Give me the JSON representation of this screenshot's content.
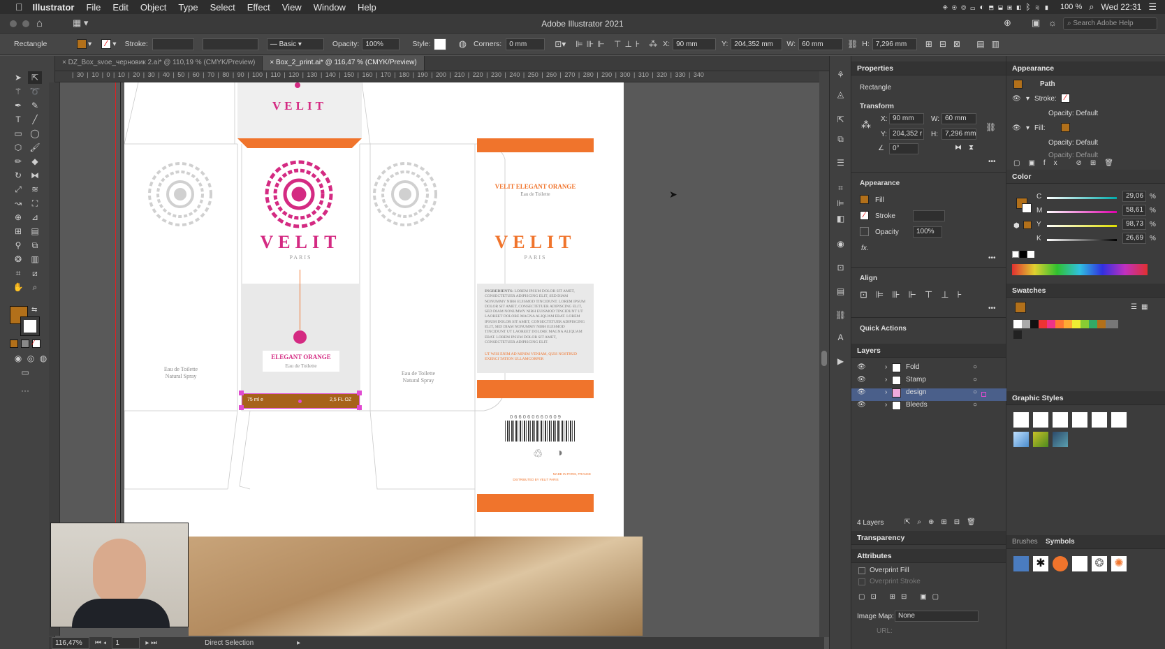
{
  "menubar": {
    "app": "Illustrator",
    "items": [
      "File",
      "Edit",
      "Object",
      "Type",
      "Select",
      "Effect",
      "View",
      "Window",
      "Help"
    ],
    "battery": "100 %",
    "clock": "Wed 22:31"
  },
  "window": {
    "title": "Adobe Illustrator 2021",
    "search_placeholder": "Search Adobe Help"
  },
  "control": {
    "object_type": "Rectangle",
    "stroke_label": "Stroke:",
    "profile": "Basic",
    "opacity_label": "Opacity:",
    "opacity": "100%",
    "style_label": "Style:",
    "corners_label": "Corners:",
    "corners": "0 mm",
    "x_label": "X:",
    "x": "90 mm",
    "y_label": "Y:",
    "y": "204,352 mm",
    "w_label": "W:",
    "w": "60 mm",
    "h_label": "H:",
    "h": "7,296 mm"
  },
  "tabs": [
    "DZ_Box_svoe_черновик 2.ai* @ 110,19 % (CMYK/Preview)",
    "Box_2_print.ai* @ 116,47 % (CMYK/Preview)"
  ],
  "ruler": "| 30 | 10 | 0 | 10 | 20 | 30 | 40 | 50 | 60 | 70 | 80 | 90 | 100 | 110 | 120 | 130 | 140 | 150 | 160 | 170 | 180 | 190 | 200 | 210 | 220 | 230 | 240 | 250 | 260 | 270 | 280 | 290 | 300 | 310 | 320 | 330 | 340",
  "artboard": {
    "brand": "VELIT",
    "city": "PARIS",
    "left_label1": "Eau de Toilette",
    "left_label2": "Natural Spray",
    "mid_label1": "Eau de Toilette",
    "mid_label2": "Natural Spray",
    "product": "ELEGANT ORANGE",
    "product_sub": "Eau de Toilette",
    "strip_left": "75 ml e",
    "strip_right": "2,5 FL OZ",
    "side_title": "VELIT ELEGANT ORANGE",
    "side_sub": "Eau de Toilette",
    "ingredients_title": "INGREDIENTS:",
    "ingredients": "LOREM IPSUM DOLOR SIT AMET, CONSECTETUER ADIPISCING ELIT, SED DIAM NONUMMY NIBH EUISMOD TINCIDUNT. LOREM IPSUM DOLOR SIT AMET, CONSECTETUER ADIPISCING ELIT, SED DIAM NONUMMY NIBH EUISMOD TINCIDUNT UT LAOREET DOLORE MAGNA ALIQUAM ERAT. LOREM IPSUM DOLOR SIT AMET, CONSECTETUER ADIPISCING ELIT, SED DIAM NONUMMY NIBH EUISMOD TINCIDUNT UT LAOREET DOLORE MAGNA ALIQUAM ERAT. LOREM IPSUM DOLOR SIT AMET, CONSECTETUER ADIPISCING ELIT.",
    "ingredients_orange": "UT WISI ENIM AD MINIM VENIAM, QUIS NOSTRUD EXERCI TATION ULLAMCORPER",
    "barcode": "0 6 6 0 6 0 6 6 0 6 0 9",
    "fine1": "MADE IN PARIS, FRANCE",
    "fine2": "DISTRIBUTED BY VELIT PARIS"
  },
  "status": {
    "zoom": "116,47%",
    "page": "1",
    "tool": "Direct Selection"
  },
  "properties": {
    "tab": "Properties",
    "type": "Rectangle",
    "transform": "Transform",
    "x_label": "X:",
    "x": "90 mm",
    "w_label": "W:",
    "w": "60 mm",
    "y_label": "Y:",
    "y": "204,352 r",
    "h_label": "H:",
    "h": "7,296 mm",
    "angle": "0°",
    "appearance": "Appearance",
    "fill": "Fill",
    "stroke": "Stroke",
    "opacity": "Opacity",
    "opacity_val": "100%",
    "fx": "fx.",
    "align": "Align",
    "quick": "Quick Actions"
  },
  "layers": {
    "title": "Layers",
    "items": [
      "Fold",
      "Stamp",
      "design",
      "Bleeds"
    ],
    "count": "4 Layers"
  },
  "transparency": "Transparency",
  "attributes": {
    "title": "Attributes",
    "overprint_fill": "Overprint Fill",
    "overprint_stroke": "Overprint Stroke",
    "image_map": "Image Map:",
    "image_map_val": "None",
    "url": "URL:"
  },
  "appearance_panel": {
    "title": "Appearance",
    "path": "Path",
    "stroke": "Stroke:",
    "opacity1": "Opacity:",
    "opacity1_val": "Default",
    "fill": "Fill:",
    "opacity2": "Opacity:",
    "opacity2_val": "Default",
    "opacity3": "Opacity: Default"
  },
  "color": {
    "title": "Color",
    "c": "29,06",
    "m": "58,61",
    "y": "98,73",
    "k": "26,69",
    "pct": "%"
  },
  "swatches": "Swatches",
  "graphic_styles": "Graphic Styles",
  "brushes": "Brushes",
  "symbols": "Symbols",
  "colors": {
    "brand_orange": "#f0742c",
    "brand_pink": "#d42a82",
    "fill_brown": "#b2701a"
  }
}
